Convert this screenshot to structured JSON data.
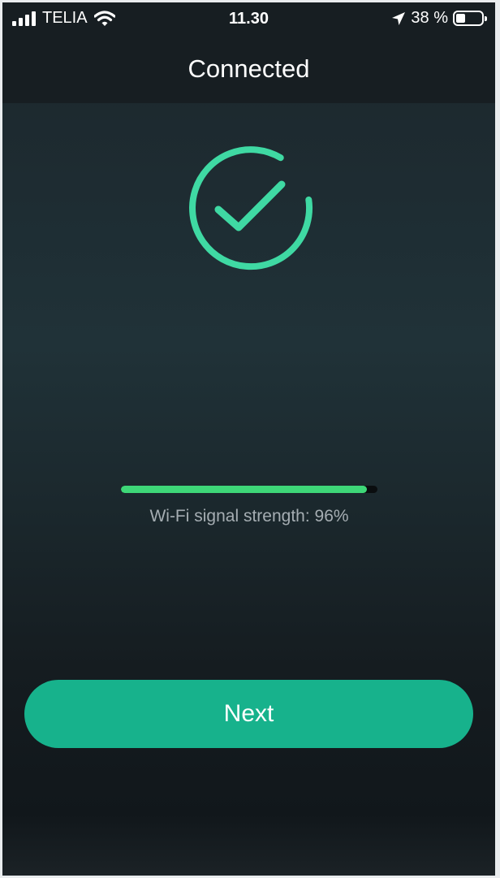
{
  "status_bar": {
    "carrier": "TELIA",
    "time": "11.30",
    "battery_label": "38 %",
    "battery_level": 0.38,
    "icons": [
      "cellular-signal-icon",
      "wifi-icon",
      "location-arrow-icon",
      "battery-icon"
    ]
  },
  "header": {
    "title": "Connected"
  },
  "status": {
    "icon": "check-circle-icon",
    "color": "#3fd9a3"
  },
  "signal": {
    "level": 0.96,
    "label": "Wi-Fi signal strength: 96%",
    "color": "#3ed778"
  },
  "next_button": {
    "label": "Next",
    "color": "#17b28c"
  }
}
